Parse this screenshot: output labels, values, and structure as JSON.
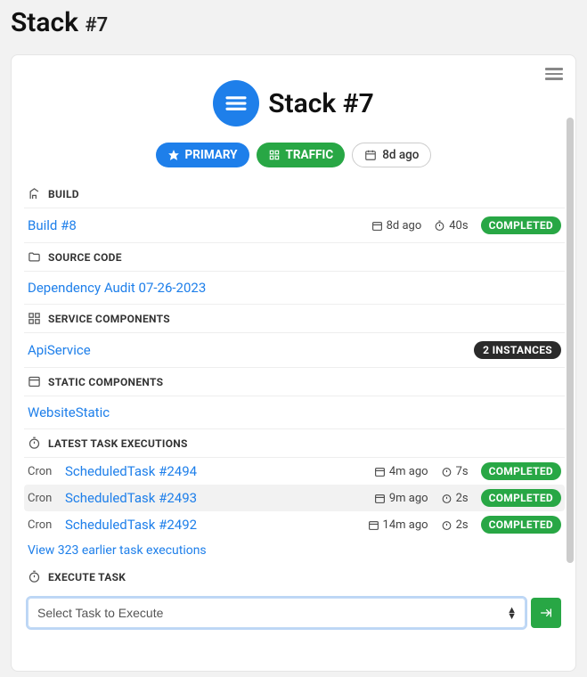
{
  "page": {
    "title_prefix": "Stack ",
    "title_num": "#7"
  },
  "header": {
    "title": "Stack #7"
  },
  "badges": {
    "primary": "PRIMARY",
    "traffic": "TRAFFIC",
    "age": "8d ago"
  },
  "sections": {
    "build": {
      "label": "BUILD",
      "item": {
        "name": "Build #8",
        "age": "8d ago",
        "duration": "40s",
        "status": "COMPLETED"
      }
    },
    "source": {
      "label": "SOURCE CODE",
      "item": {
        "name": "Dependency Audit 07-26-2023"
      }
    },
    "services": {
      "label": "SERVICE COMPONENTS",
      "item": {
        "name": "ApiService",
        "instances": "2 INSTANCES"
      }
    },
    "static": {
      "label": "STATIC COMPONENTS",
      "item": {
        "name": "WebsiteStatic"
      }
    },
    "tasks": {
      "label": "LATEST TASK EXECUTIONS",
      "items": [
        {
          "type": "Cron",
          "name": "ScheduledTask #2494",
          "age": "4m ago",
          "duration": "7s",
          "status": "COMPLETED"
        },
        {
          "type": "Cron",
          "name": "ScheduledTask #2493",
          "age": "9m ago",
          "duration": "2s",
          "status": "COMPLETED"
        },
        {
          "type": "Cron",
          "name": "ScheduledTask #2492",
          "age": "14m ago",
          "duration": "2s",
          "status": "COMPLETED"
        }
      ],
      "view_more": "View 323 earlier task executions"
    },
    "execute": {
      "label": "EXECUTE TASK",
      "placeholder": "Select Task to Execute"
    }
  }
}
